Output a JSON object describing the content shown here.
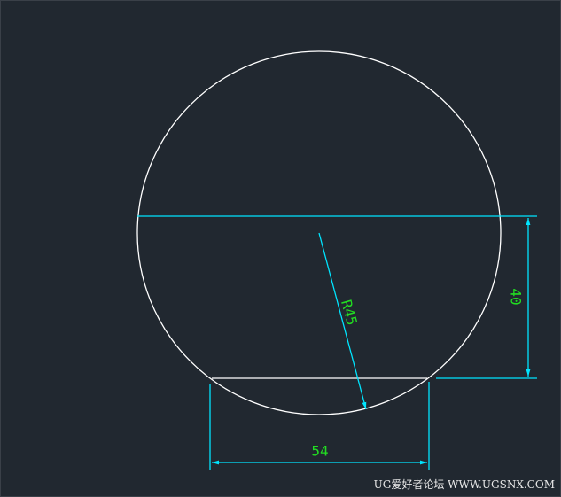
{
  "drawing": {
    "circle_radius_label": "R45",
    "chord_width_label": "54",
    "chord_offset_label": "40"
  },
  "watermark": "UG爱好者论坛 WWW.UGSNX.COM",
  "colors": {
    "background": "#212830",
    "geometry": "#ffffff",
    "dimension_lines": "#00e5ff",
    "dimension_text": "#22dd22"
  }
}
